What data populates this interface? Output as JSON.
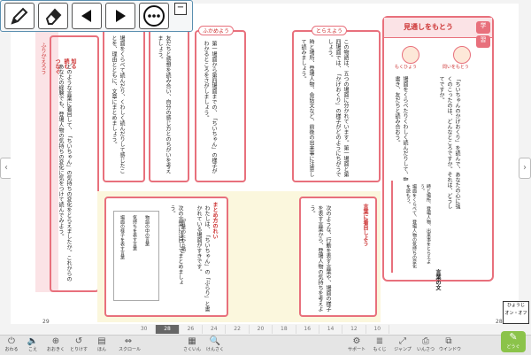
{
  "palette": {
    "pen_icon": "pencil-icon",
    "eraser_icon": "eraser-icon",
    "prev_icon": "triangle-left-icon",
    "next_icon": "triangle-right-icon",
    "more_icon": "ellipsis-icon",
    "minimize_label": "−"
  },
  "colors": {
    "accent_pink": "#e8707c",
    "page_yellow": "#fbf7dd",
    "pink_bg": "#fbe3e6"
  },
  "left_page": {
    "sidebar_label": "ふりかえろう",
    "sidebar_headings": [
      "知る",
      "読む",
      "つなぐ"
    ],
    "col1_text": "どのような言葉に着目して、「ちいちゃん」の気持ちの変化をとらえましたか。これからのあなたの経験でも、登場人物の気持ちの変化に気をつけて読んでみよう。",
    "col2_text": "場面をくらべて読んだり、くわしく読んだりして感じたことを、理由とともに、文章にまとめましょう。",
    "col3_text": "友だちと感想を読み合い、自分の感じ方とのちがいを考えましょう。",
    "fukame_tag": "ふかめよう",
    "col4_text": "第一場面から第四場面までの、「ちいちゃん」の様子がわかるところをさがしましょう。",
    "toraeyou_tag": "とらえよう",
    "col5_text": "この物語は、五つの場面に分かれています。第一場面と第四場面では、「かげおくり」の様子がどのようにちがうでしょう。",
    "col6_text": "時と場所、登場人物、会話文など、前後の出来事に注意して読みましょう。",
    "bottom_heading": "まとめ方のれい",
    "bottom_text1": "わたしは、「ちいちゃん」の「ぶらり」と書かれている場面がすきです。",
    "bottom_note": "「言葉のたから箱」",
    "bottom_text2": "次の言葉に注目してまとめましょう。",
    "bottom_list": [
      "物語の中の言葉",
      "気持ちを表す言葉",
      "場面の様子を表す言葉"
    ],
    "bottom_right_heading": "言葉に着目しよう",
    "bottom_right_text": "次のような、行動を表す言葉や、場面の様子を表す言葉から、登場人物の気持ちを考えよう。",
    "page_number": "29"
  },
  "right_page": {
    "box_title": "見通しをもとう",
    "side_badges": [
      "学",
      "習"
    ],
    "char1_label": "もくひょう",
    "char2_label": "問いをもとう",
    "main_text": "「ちいちゃんのかげおくり」を読んで、あなたの心に強くのこったのは、どんなところですか。それは、どうしてですか。",
    "sub_text": "場面をくらべたりくわしく読んだりして、物語の感想を書き、友だちと読み合おう。",
    "bullets": [
      "時と場所、登場人物、出来事をとらえよう。",
      "場面をくらべて、登場人物の気持ちの変化を読もう。"
    ],
    "new_word_label": "言葉の文",
    "page_number": "28",
    "hyouji_label": "ひょうじ",
    "onoff_label": "オン・オフ"
  },
  "pager": [
    "30",
    "28",
    "26",
    "24",
    "22",
    "20",
    "18",
    "16",
    "14",
    "12",
    "10"
  ],
  "pager_current": "28",
  "bottombar": [
    {
      "icon": "power-icon",
      "glyph": "⏻",
      "label": "おわる"
    },
    {
      "icon": "speaker-icon",
      "glyph": "🔈",
      "label": "こえ"
    },
    {
      "icon": "zoom-in-icon",
      "glyph": "⊕",
      "label": "おおきく"
    },
    {
      "icon": "undo-icon",
      "glyph": "↺",
      "label": "とりけす"
    },
    {
      "icon": "book-icon",
      "glyph": "▤",
      "label": "ほん"
    },
    {
      "icon": "scroll-icon",
      "glyph": "⇔",
      "label": "スクロール"
    },
    {
      "icon": "grid-icon",
      "glyph": "▦",
      "label": "さくいん"
    },
    {
      "icon": "search-icon",
      "glyph": "🔍",
      "label": "けんさく"
    },
    {
      "icon": "gear-icon",
      "glyph": "⚙",
      "label": "サポート"
    },
    {
      "icon": "list-icon",
      "glyph": "≣",
      "label": "もくじ"
    },
    {
      "icon": "jump-icon",
      "glyph": "⤢",
      "label": "ジャンプ"
    },
    {
      "icon": "print-icon",
      "glyph": "⎙",
      "label": "いんさつ"
    },
    {
      "icon": "window-icon",
      "glyph": "⧉",
      "label": "ウインドウ"
    }
  ],
  "corner_button_label": "どうぐ"
}
